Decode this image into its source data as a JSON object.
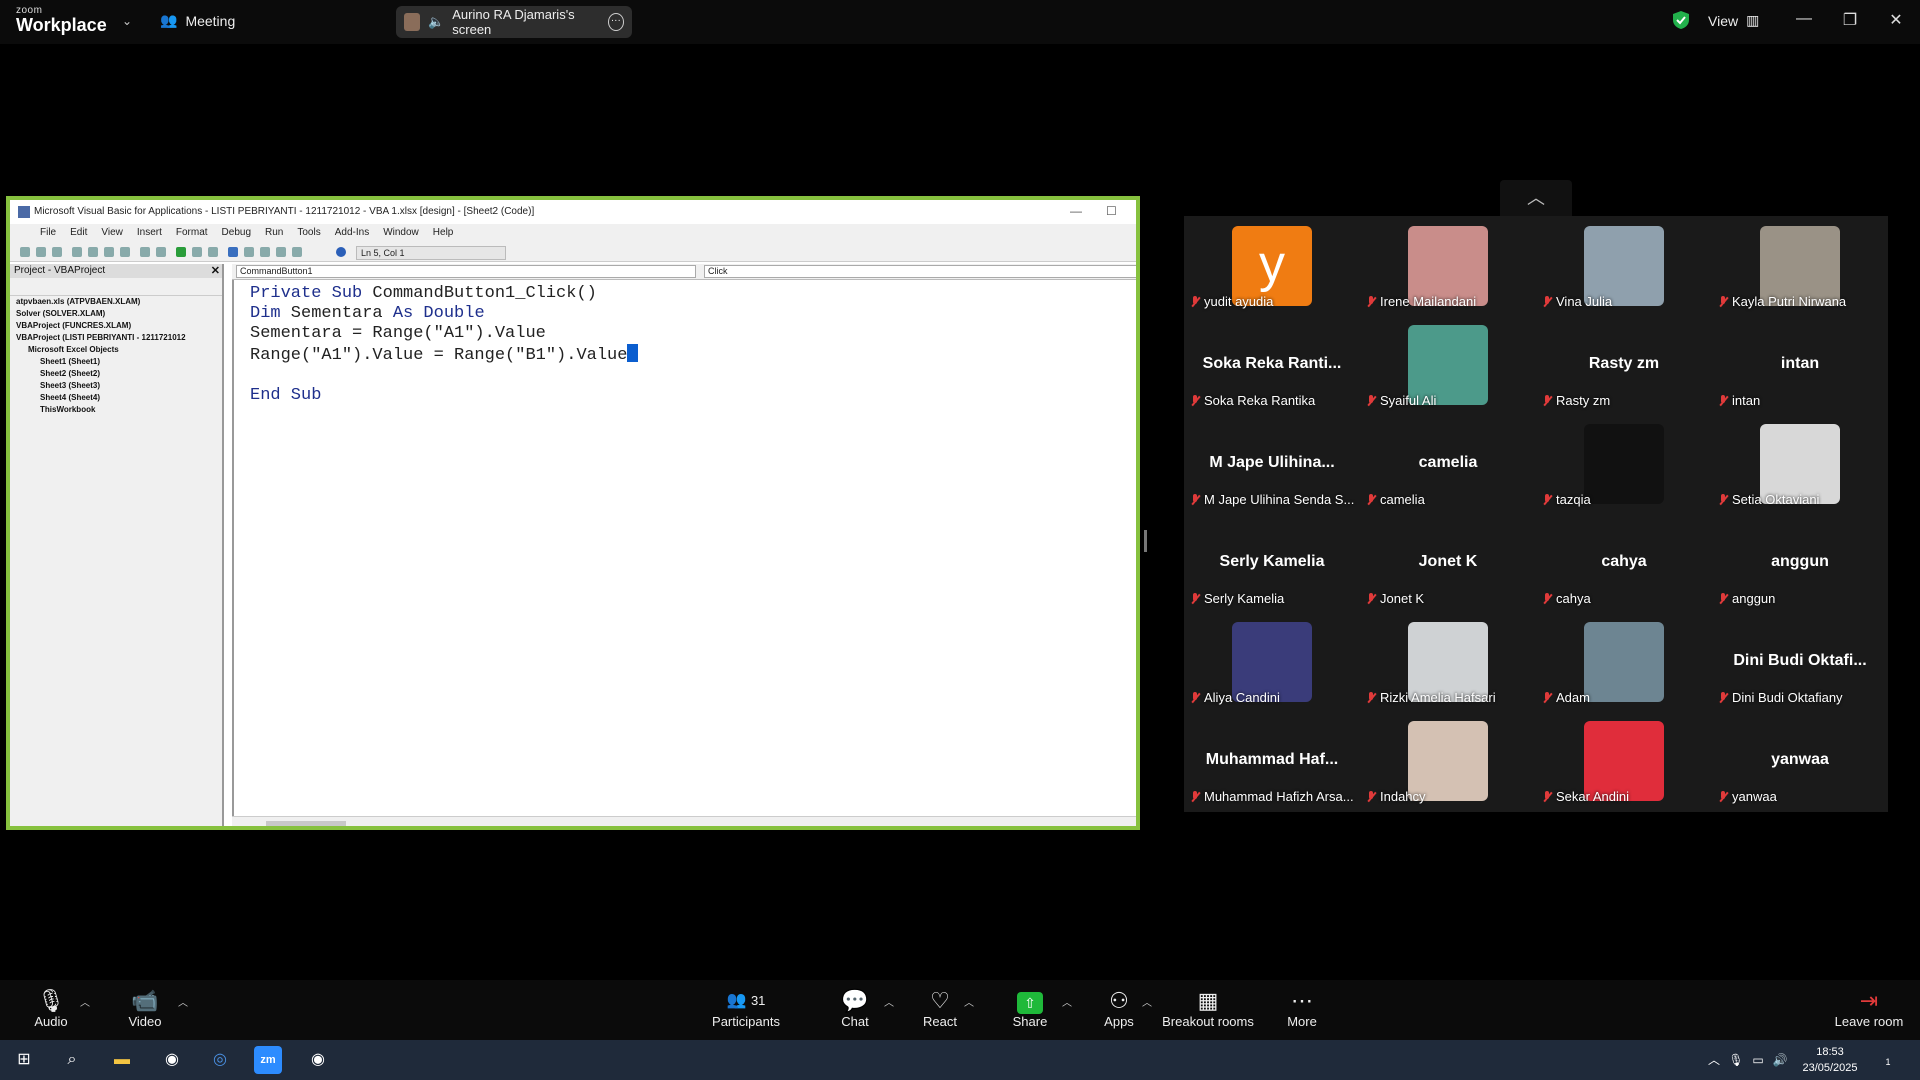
{
  "app": {
    "logo_small": "zoom",
    "logo_big": "Workplace",
    "meeting_label": "Meeting"
  },
  "share_pill": {
    "label": "Aurino RA Djamaris's screen"
  },
  "header": {
    "view_label": "View"
  },
  "vba": {
    "title": "Microsoft Visual Basic for Applications - LISTI PEBRIYANTI - 1211721012 - VBA 1.xlsx [design] - [Sheet2 (Code)]",
    "menu": [
      "File",
      "Edit",
      "View",
      "Insert",
      "Format",
      "Debug",
      "Run",
      "Tools",
      "Add-Ins",
      "Window",
      "Help"
    ],
    "position": "Ln 5, Col 1",
    "project_title": "Project - VBAProject",
    "tree": [
      "atpvbaen.xls (ATPVBAEN.XLAM)",
      "Solver (SOLVER.XLAM)",
      "VBAProject (FUNCRES.XLAM)",
      "VBAProject (LISTI PEBRIYANTI - 1211721012",
      "Microsoft Excel Objects",
      "Sheet1 (Sheet1)",
      "Sheet2 (Sheet2)",
      "Sheet3 (Sheet3)",
      "Sheet4 (Sheet4)",
      "ThisWorkbook"
    ],
    "object_combo": "CommandButton1",
    "proc_combo": "Click",
    "code": {
      "l1a": "Private Sub",
      "l1b": " CommandButton1_Click()",
      "l2a": "Dim",
      "l2b": " Sementara ",
      "l2c": "As Double",
      "l3": "Sementara = Range(\"A1\").Value",
      "l4": "Range(\"A1\").Value = Range(\"B1\").Value",
      "l6": "End Sub"
    }
  },
  "gallery": {
    "participants": [
      {
        "big": "",
        "name": "yudit ayudia",
        "avatar_letter": "y",
        "color": "#f07c12"
      },
      {
        "big": "",
        "name": "Irene Mailandani",
        "color": "#c98d8a"
      },
      {
        "big": "",
        "name": "Vina Julia",
        "color": "#8fa0ad"
      },
      {
        "big": "",
        "name": "Kayla Putri Nirwana",
        "color": "#9a9286"
      },
      {
        "big": "Soka Reka Ranti...",
        "name": "Soka Reka Rantika"
      },
      {
        "big": "",
        "name": "Syaiful Ali",
        "color": "#4c9a8a"
      },
      {
        "big": "Rasty zm",
        "name": "Rasty zm"
      },
      {
        "big": "intan",
        "name": "intan"
      },
      {
        "big": "M Jape Ulihina...",
        "name": "M Jape Ulihina Senda S..."
      },
      {
        "big": "camelia",
        "name": "camelia"
      },
      {
        "big": "",
        "name": "tazqia",
        "color": "#111111"
      },
      {
        "big": "",
        "name": "Setia Oktaviani",
        "color": "#d8d8d8"
      },
      {
        "big": "Serly Kamelia",
        "name": "Serly Kamelia"
      },
      {
        "big": "Jonet K",
        "name": "Jonet K"
      },
      {
        "big": "cahya",
        "name": "cahya"
      },
      {
        "big": "anggun",
        "name": "anggun"
      },
      {
        "big": "",
        "name": "Aliya Candini",
        "color": "#3a3c7a"
      },
      {
        "big": "",
        "name": "Rizki Amelia Hafsari",
        "color": "#cfd2d4"
      },
      {
        "big": "",
        "name": "Adam",
        "color": "#6d8592"
      },
      {
        "big": "Dini Budi Oktafi...",
        "name": "Dini Budi Oktafiany"
      },
      {
        "big": "Muhammad Haf...",
        "name": "Muhammad Hafizh Arsa..."
      },
      {
        "big": "",
        "name": "Indahcy",
        "color": "#d4c1b3"
      },
      {
        "big": "",
        "name": "Sekar Andini",
        "color": "#e02d3b"
      },
      {
        "big": "yanwaa",
        "name": "yanwaa"
      }
    ]
  },
  "toolbar": {
    "audio": "Audio",
    "video": "Video",
    "participants": "Participants",
    "participants_count": "31",
    "chat": "Chat",
    "react": "React",
    "share": "Share",
    "apps": "Apps",
    "breakout": "Breakout rooms",
    "more": "More",
    "leave": "Leave room"
  },
  "taskbar": {
    "time": "18:53",
    "date": "23/05/2025",
    "notifications": "1"
  }
}
